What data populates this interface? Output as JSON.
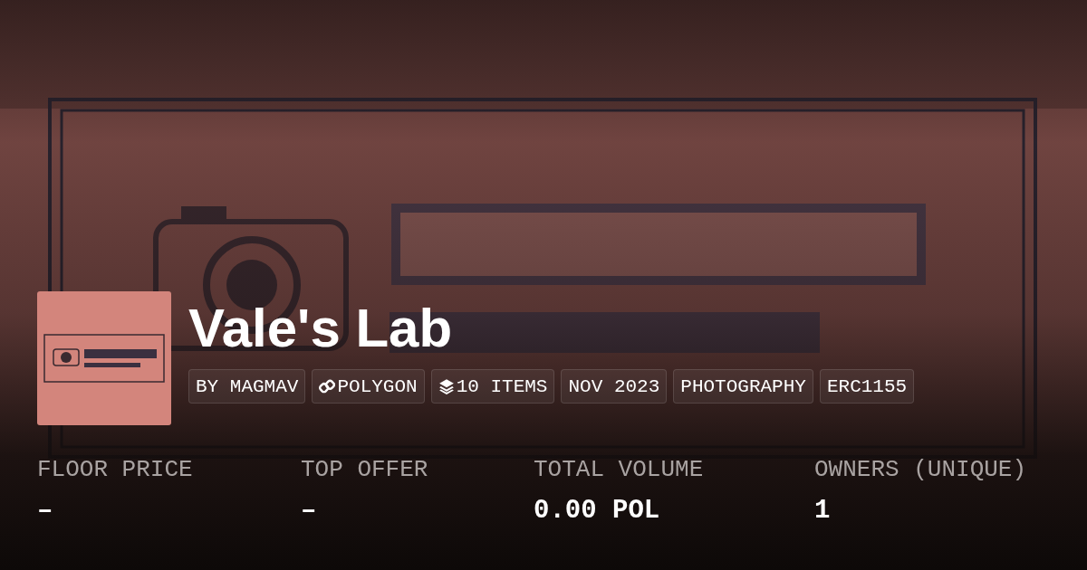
{
  "collection": {
    "title": "Vale's Lab"
  },
  "tags": [
    {
      "kind": "text",
      "label": "BY MAGMAV"
    },
    {
      "kind": "chain",
      "label": "POLYGON"
    },
    {
      "kind": "items",
      "label": "10 ITEMS"
    },
    {
      "kind": "text",
      "label": "NOV 2023"
    },
    {
      "kind": "text",
      "label": "PHOTOGRAPHY"
    },
    {
      "kind": "text",
      "label": "ERC1155"
    }
  ],
  "stats": [
    {
      "label": "FLOOR PRICE",
      "value": "–"
    },
    {
      "label": "TOP OFFER",
      "value": "–"
    },
    {
      "label": "TOTAL VOLUME",
      "value": "0.00 POL"
    },
    {
      "label": "OWNERS (UNIQUE)",
      "value": "1"
    }
  ]
}
